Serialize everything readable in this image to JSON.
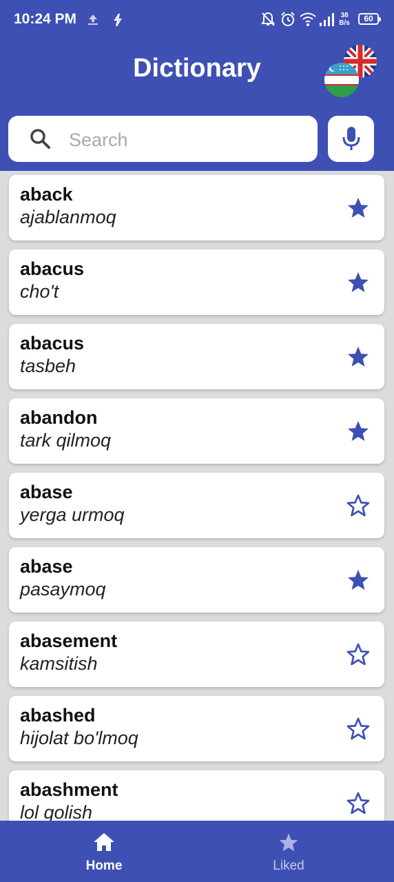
{
  "status": {
    "time": "10:24 PM",
    "net_speed_value": "38",
    "net_speed_unit": "B/s",
    "battery": "60"
  },
  "header": {
    "title": "Dictionary"
  },
  "search": {
    "placeholder": "Search"
  },
  "entries": [
    {
      "word": "aback",
      "translation": "ajablanmoq",
      "liked": true
    },
    {
      "word": "abacus",
      "translation": "cho't",
      "liked": true
    },
    {
      "word": "abacus",
      "translation": "tasbeh",
      "liked": true
    },
    {
      "word": "abandon",
      "translation": "tark qilmoq",
      "liked": true
    },
    {
      "word": "abase",
      "translation": "yerga urmoq",
      "liked": false
    },
    {
      "word": "abase",
      "translation": "pasaymoq",
      "liked": true
    },
    {
      "word": "abasement",
      "translation": "kamsitish",
      "liked": false
    },
    {
      "word": "abashed",
      "translation": "hijolat bo'lmoq",
      "liked": false
    },
    {
      "word": "abashment",
      "translation": "lol qolish",
      "liked": false
    }
  ],
  "bottom_nav": {
    "items": [
      {
        "label": "Home",
        "icon": "home-icon",
        "active": true
      },
      {
        "label": "Liked",
        "icon": "star-icon",
        "active": false
      }
    ]
  },
  "colors": {
    "primary": "#3e50b4",
    "star": "#3e50b4",
    "inactive_nav": "#c5cae9"
  }
}
